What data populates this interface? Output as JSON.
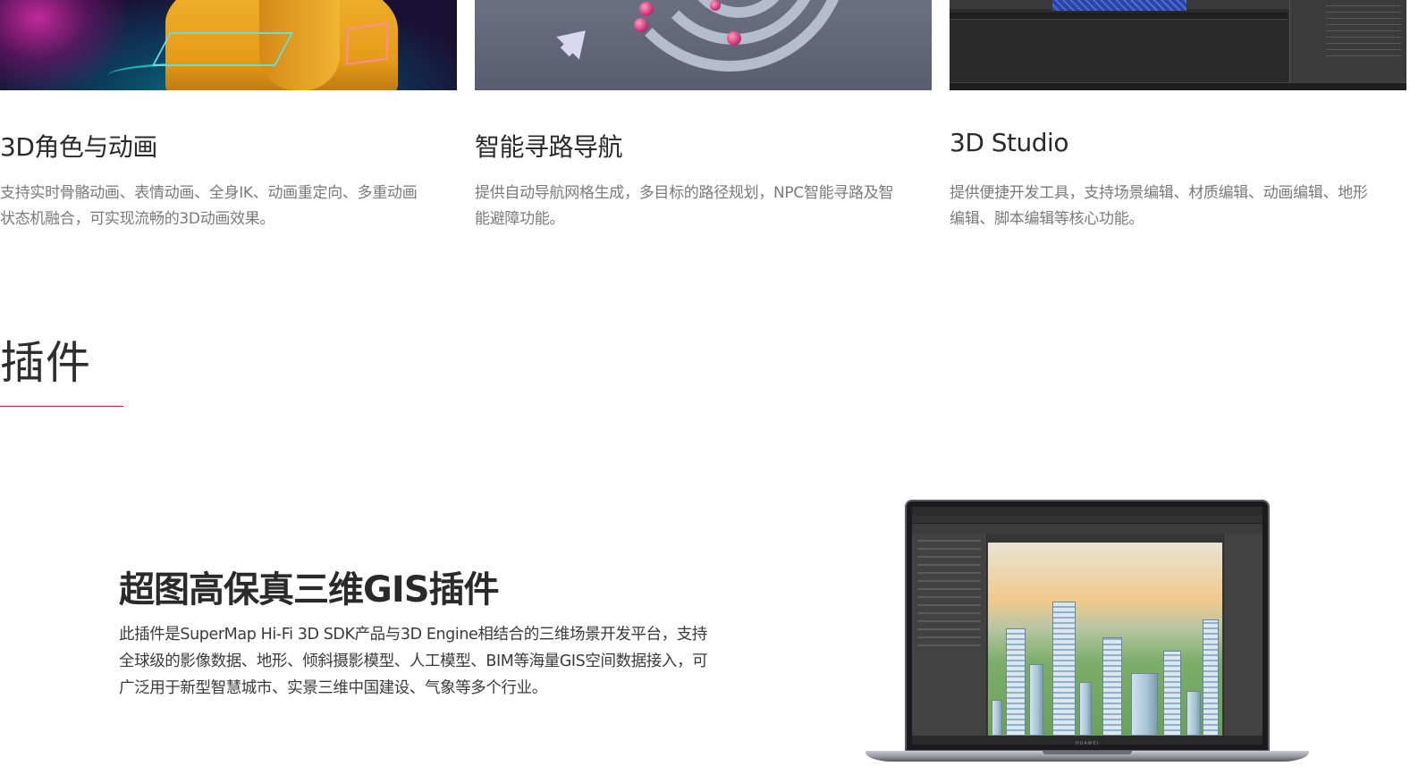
{
  "features": [
    {
      "title": "3D角色与动画",
      "description": "支持实时骨骼动画、表情动画、全身IK、动画重定向、多重动画状态机融合，可实现流畅的3D动画效果。",
      "image": "3d-character-animation-illustration"
    },
    {
      "title": "智能寻路导航",
      "description": "提供自动导航网格生成，多目标的路径规划，NPC智能寻路及智能避障功能。",
      "image": "pathfinding-navigation-illustration"
    },
    {
      "title": "3D Studio",
      "description": "提供便捷开发工具，支持场景编辑、材质编辑、动画编辑、地形编辑、脚本编辑等核心功能。",
      "image": "3d-studio-editor-screenshot"
    }
  ],
  "section": {
    "title": "插件",
    "accent_color": "#c81d38"
  },
  "plugin": {
    "title": "超图高保真三维GIS插件",
    "description": "此插件是SuperMap Hi-Fi 3D SDK产品与3D Engine相结合的三维场景开发平台，支持全球级的影像数据、地形、倾斜摄影模型、人工模型、BIM等海量GIS空间数据接入，可广泛用于新型智慧城市、实景三维中国建设、气象等多个行业。",
    "image": "laptop-3d-gis-city-scene",
    "laptop_brand": "HUAWEI"
  }
}
